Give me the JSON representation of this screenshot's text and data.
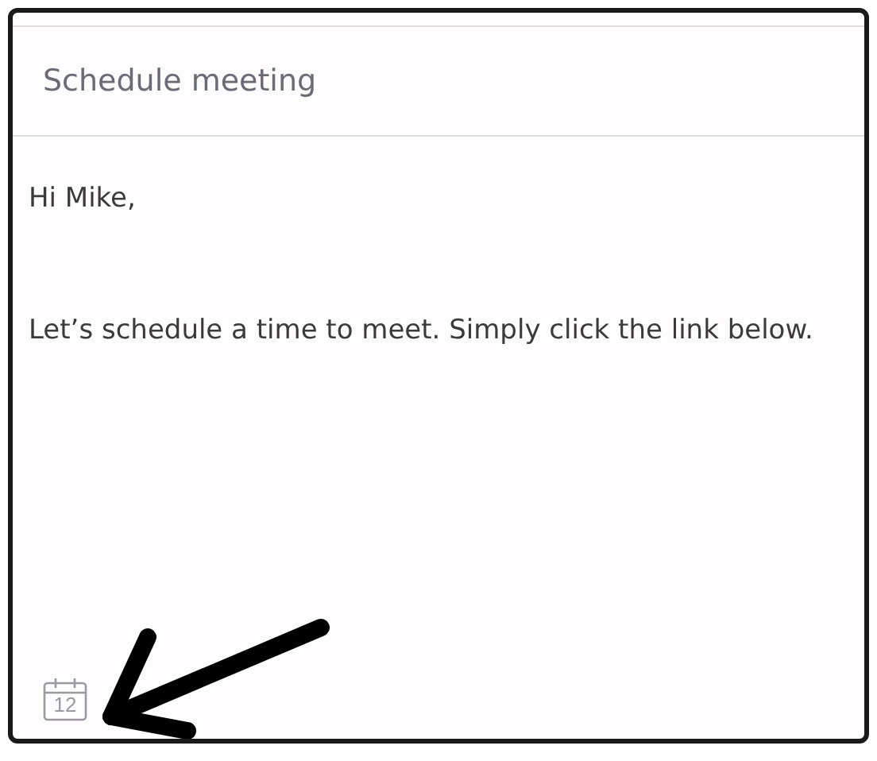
{
  "subject": {
    "value": "Schedule meeting"
  },
  "body": {
    "paragraphs": [
      "Hi Mike,",
      "Let’s schedule a time to meet. Simply click the link below."
    ]
  },
  "calendar_button": {
    "day": "12"
  },
  "annotation": {
    "kind": "arrow"
  }
}
